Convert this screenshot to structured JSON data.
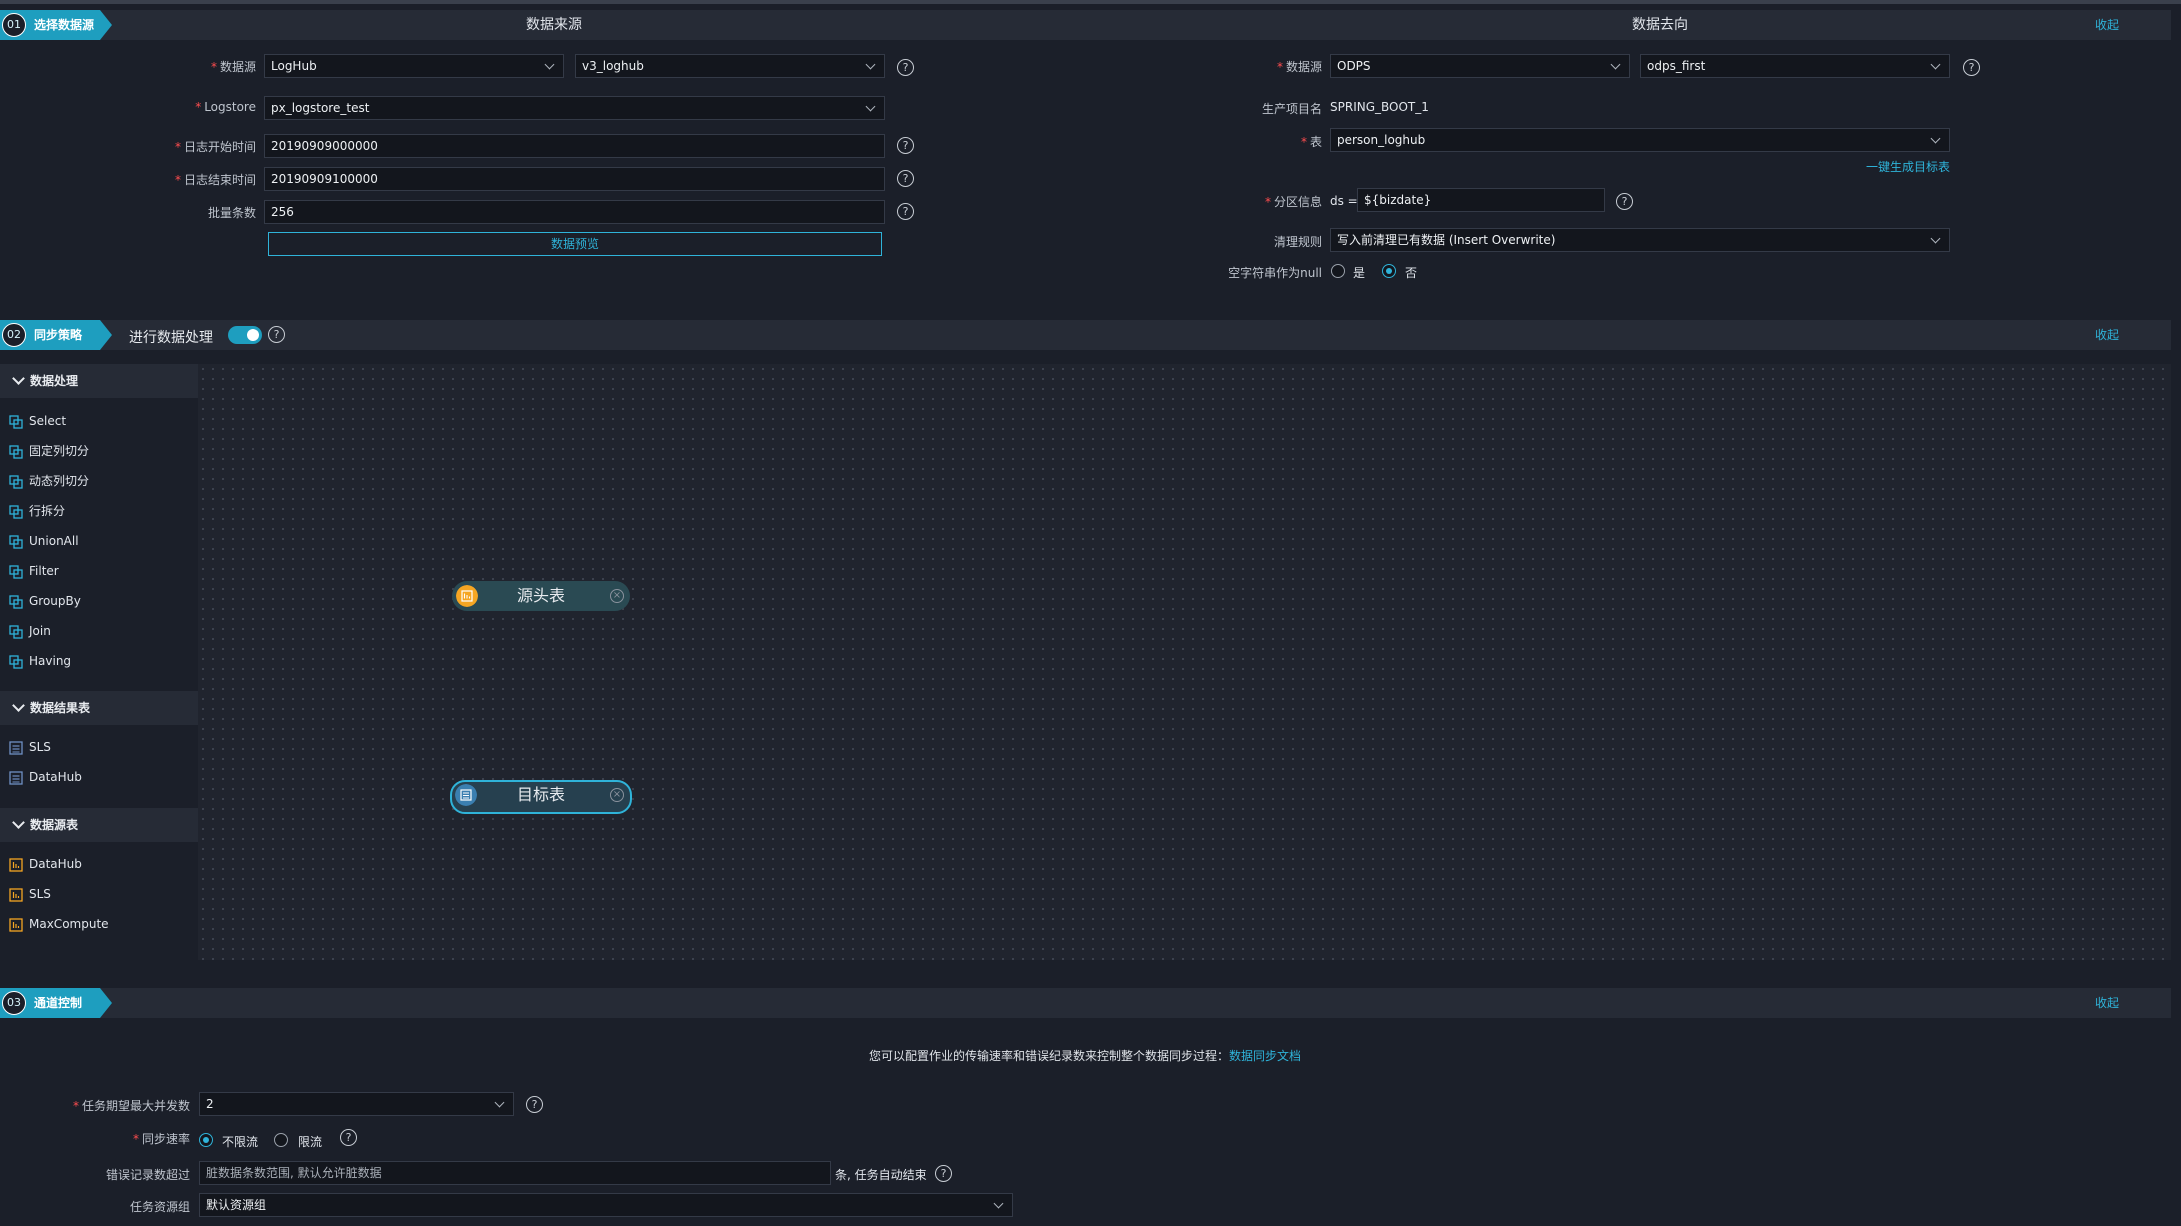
{
  "section1": {
    "num": "01",
    "label": "选择数据源",
    "collapse": "收起",
    "source": {
      "title": "数据来源",
      "datasource_label": "数据源",
      "datasource_type": "LogHub",
      "datasource_name": "v3_loghub",
      "logstore_label": "Logstore",
      "logstore_value": "px_logstore_test",
      "start_label": "日志开始时间",
      "start_value": "20190909000000",
      "end_label": "日志结束时间",
      "end_value": "20190909100000",
      "batch_label": "批量条数",
      "batch_value": "256",
      "preview_button": "数据预览"
    },
    "target": {
      "title": "数据去向",
      "datasource_label": "数据源",
      "datasource_type": "ODPS",
      "datasource_name": "odps_first",
      "project_label": "生产项目名",
      "project_value": "SPRING_BOOT_1",
      "table_label": "表",
      "table_value": "person_loghub",
      "gen_table_link": "一键生成目标表",
      "partition_label": "分区信息",
      "partition_prefix": "ds =",
      "partition_value": "${bizdate}",
      "clean_label": "清理规则",
      "clean_value": "写入前清理已有数据 (Insert Overwrite)",
      "null_label": "空字符串作为null",
      "null_yes": "是",
      "null_no": "否"
    }
  },
  "section2": {
    "num": "02",
    "label": "同步策略",
    "collapse": "收起",
    "process_label": "进行数据处理",
    "groups": [
      {
        "title": "数据处理",
        "items": [
          "Select",
          "固定列切分",
          "动态列切分",
          "行拆分",
          "UnionAll",
          "Filter",
          "GroupBy",
          "Join",
          "Having"
        ]
      },
      {
        "title": "数据结果表",
        "items": [
          "SLS",
          "DataHub"
        ]
      },
      {
        "title": "数据源表",
        "items": [
          "DataHub",
          "SLS",
          "MaxCompute"
        ]
      }
    ],
    "nodes": {
      "source": "源头表",
      "target": "目标表"
    }
  },
  "section3": {
    "num": "03",
    "label": "通道控制",
    "collapse": "收起",
    "notice": "您可以配置作业的传输速率和错误纪录数来控制整个数据同步过程：",
    "notice_link": "数据同步文档",
    "concurrency_label": "任务期望最大并发数",
    "concurrency_value": "2",
    "rate_label": "同步速率",
    "rate_unlimited": "不限流",
    "rate_limited": "限流",
    "error_label": "错误记录数超过",
    "error_placeholder": "脏数据条数范围, 默认允许脏数据",
    "error_suffix": "条, 任务自动结束",
    "resource_label": "任务资源组",
    "resource_value": "默认资源组"
  },
  "colors": {
    "accent": "#1e9ebf",
    "link": "#2fb3d9",
    "required": "#ff4d4f",
    "source_node_icon": "#f5a623"
  },
  "icons": {
    "help": "question-circle-icon",
    "source_table": "source-table-icon",
    "result_table": "result-table-icon",
    "process": "process-node-icon"
  }
}
